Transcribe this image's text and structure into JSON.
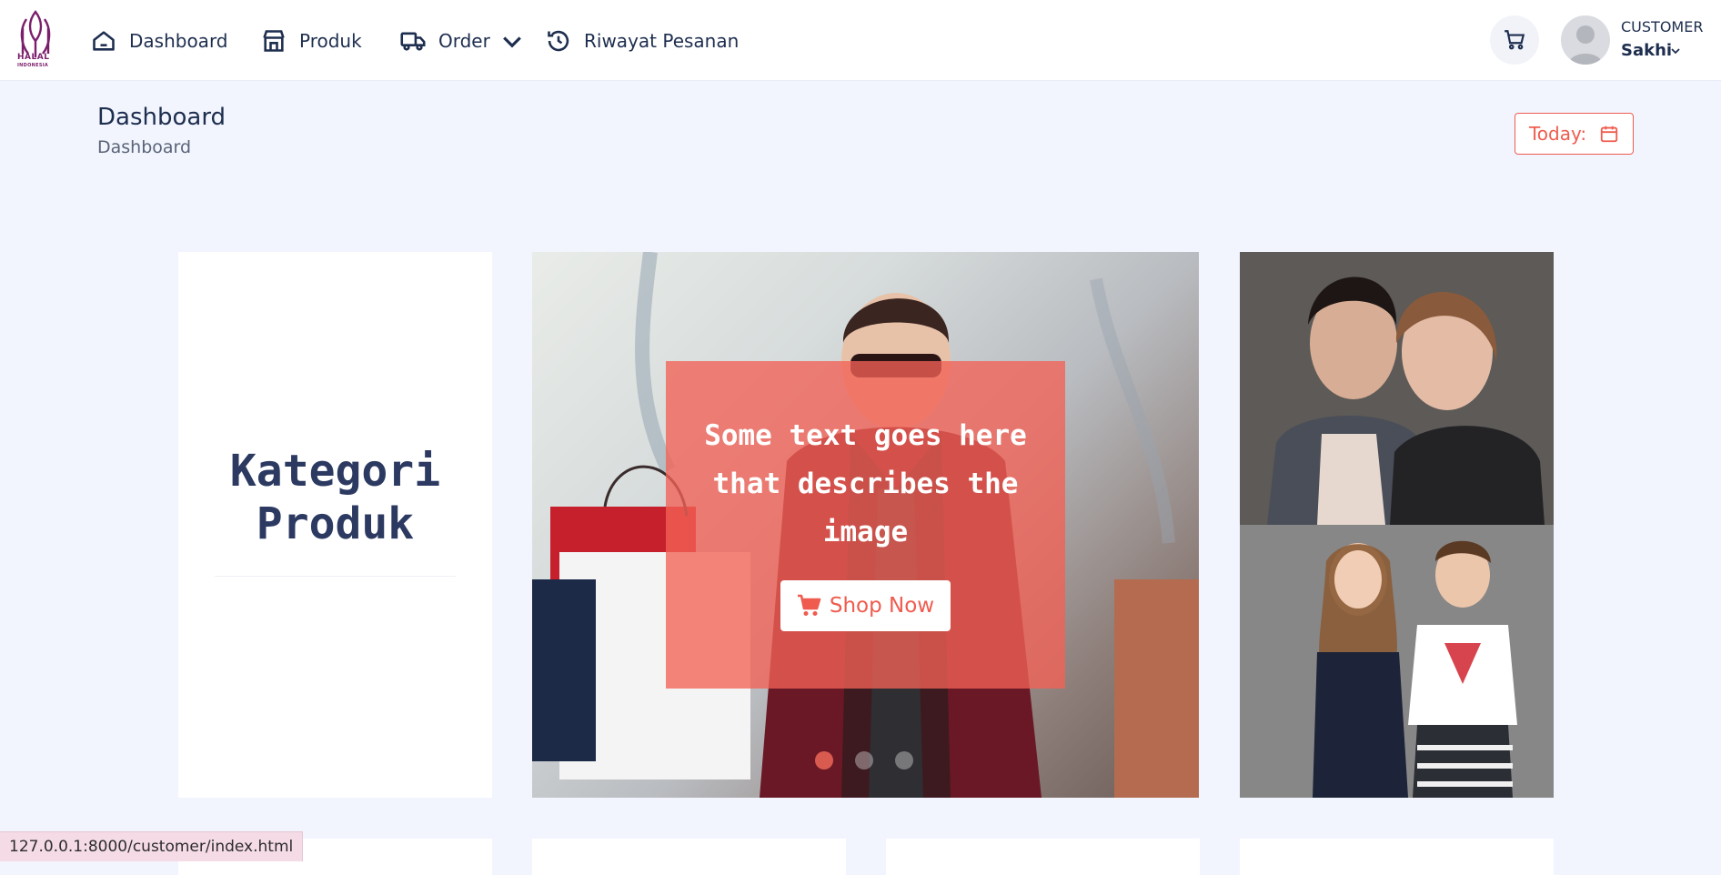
{
  "brand": {
    "logo_line1": "HALAL",
    "logo_line2": "INDONESIA"
  },
  "nav": {
    "items": [
      {
        "label": "Dashboard",
        "icon": "home-icon"
      },
      {
        "label": "Produk",
        "icon": "store-icon"
      },
      {
        "label": "Order",
        "icon": "truck-icon",
        "has_dropdown": true
      },
      {
        "label": "Riwayat Pesanan",
        "icon": "history-icon"
      }
    ]
  },
  "user": {
    "role": "CUSTOMER",
    "name": "Sakhi"
  },
  "header": {
    "title": "Dashboard",
    "breadcrumb": "Dashboard",
    "today_label": "Today:"
  },
  "category_card": {
    "title": "Kategori Produk"
  },
  "hero": {
    "caption": "Some text goes here that describes the image",
    "button_label": "Shop Now",
    "slides_total": 3,
    "active_slide": 1
  },
  "status_bar": {
    "url": "127.0.0.1:8000/customer/index.html"
  },
  "colors": {
    "accent": "#ef5c4f",
    "navy": "#1e2e4f",
    "background": "#f2f5fd",
    "brand_purple": "#7b1e6b"
  }
}
